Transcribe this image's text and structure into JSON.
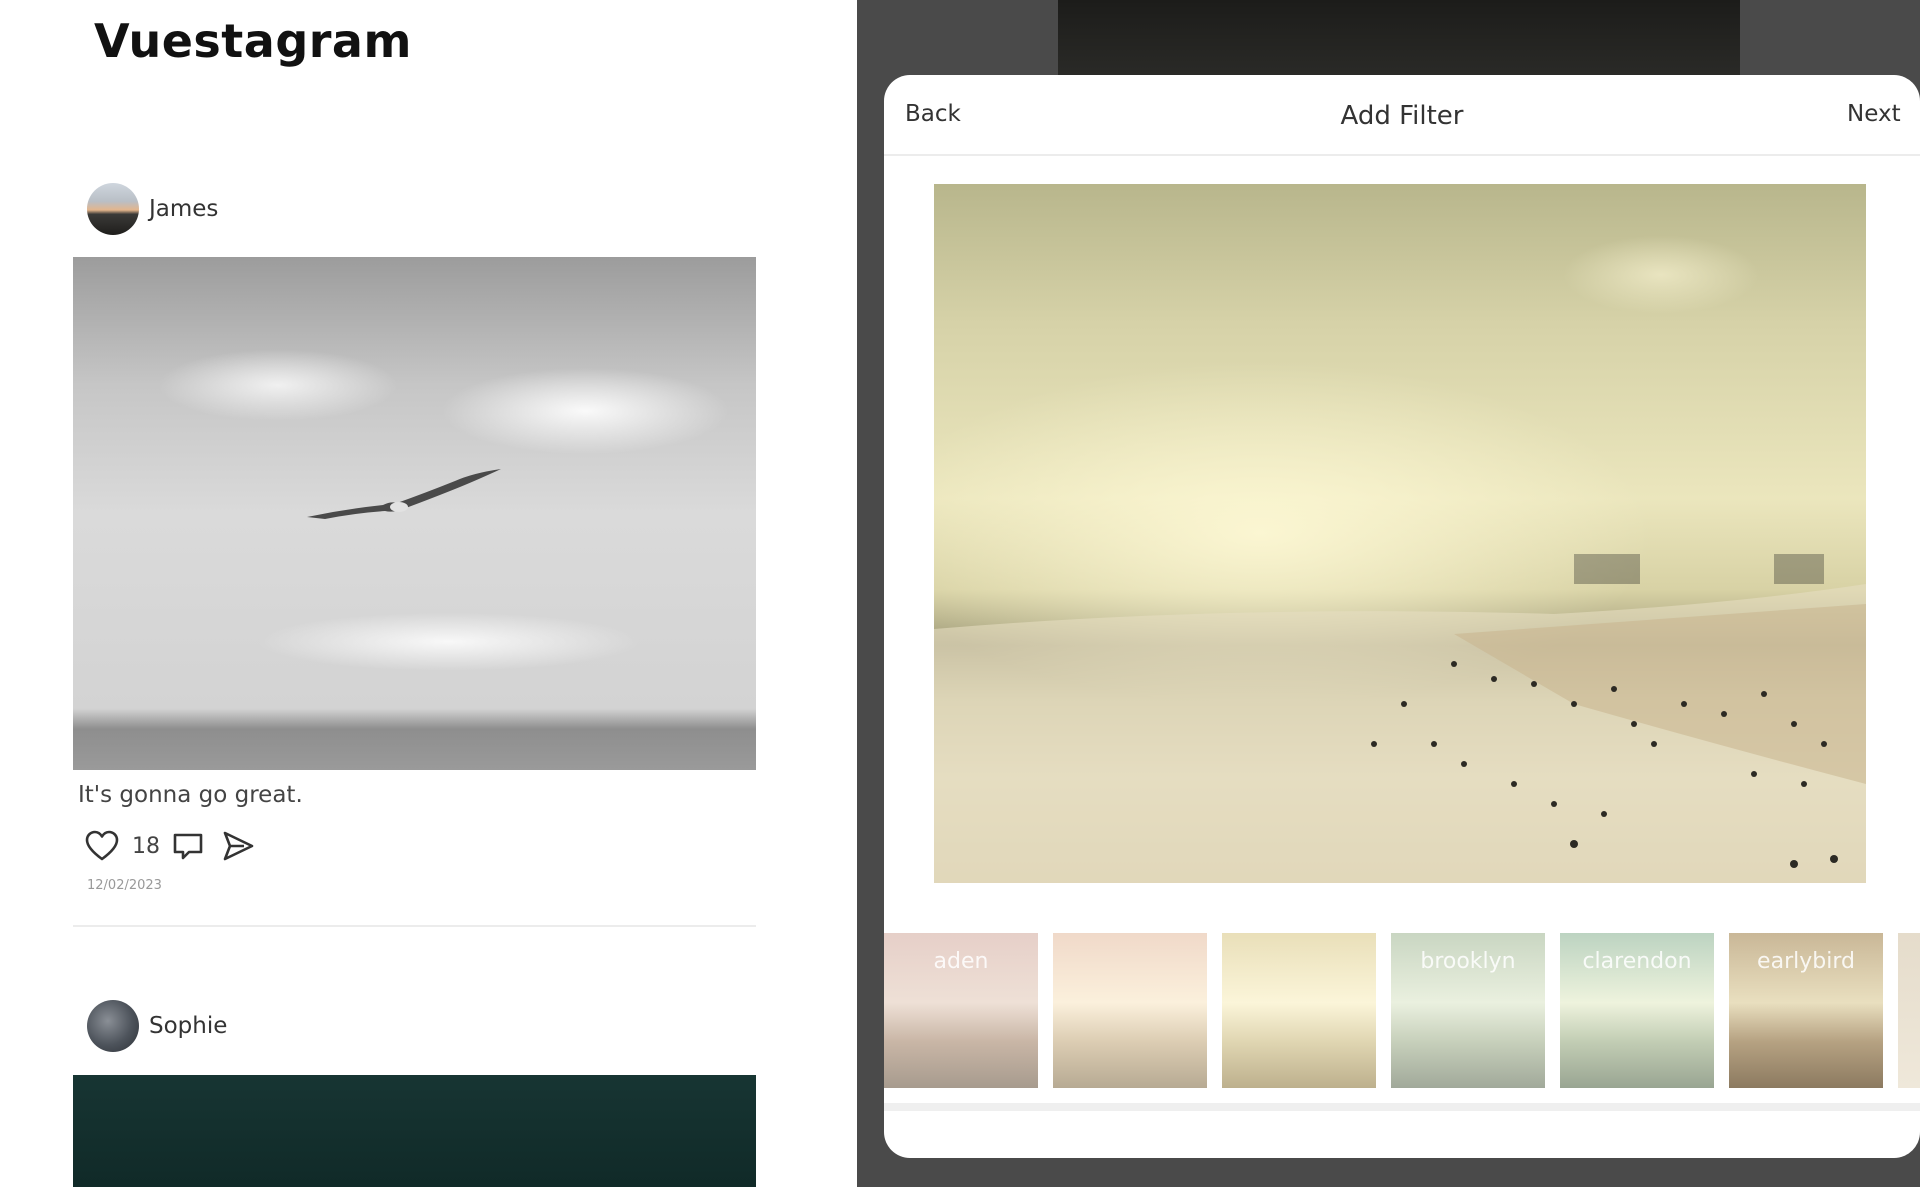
{
  "app": {
    "title": "Vuestagram"
  },
  "feed": {
    "posts": [
      {
        "user": "James",
        "caption": "It's gonna go great.",
        "likes": "18",
        "date": "12/02/2023"
      },
      {
        "user": "Sophie"
      }
    ]
  },
  "modal": {
    "back_label": "Back",
    "title": "Add Filter",
    "next_label": "Next",
    "filters": [
      {
        "label": "aden"
      },
      {
        "label": ""
      },
      {
        "label": ""
      },
      {
        "label": "brooklyn"
      },
      {
        "label": "clarendon"
      },
      {
        "label": "earlybird"
      },
      {
        "label": ""
      }
    ]
  },
  "icons": {
    "like": "heart-icon",
    "comment": "comment-icon",
    "share": "send-icon"
  }
}
